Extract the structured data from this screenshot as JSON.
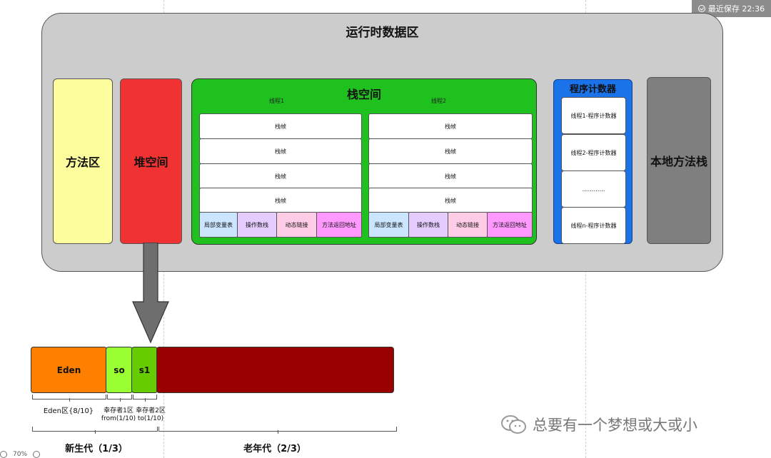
{
  "save_status": "最近保存 22:36",
  "runtime": {
    "title": "运行时数据区",
    "method_area": "方法区",
    "heap": "堆空间",
    "native_stack": "本地方法栈",
    "stack": {
      "title": "栈空间",
      "threads": [
        {
          "label": "线程1",
          "frames": [
            "栈帧",
            "栈帧",
            "栈帧",
            "栈帧"
          ],
          "parts": [
            "局部变量表",
            "操作数栈",
            "动态链接",
            "方法返回地址"
          ]
        },
        {
          "label": "线程2",
          "frames": [
            "栈帧",
            "栈帧",
            "栈帧",
            "栈帧"
          ],
          "parts": [
            "局部变量表",
            "操作数栈",
            "动态链接",
            "方法返回地址"
          ]
        }
      ]
    },
    "pc_register": {
      "title": "程序计数器",
      "items": [
        "线程1-程序计数器",
        "线程2-程序计数器",
        "…………",
        "线程n-程序计数器"
      ]
    }
  },
  "heap_layout": {
    "eden": "Eden",
    "s0": "so",
    "s1": "s1",
    "eden_label": "Eden区{8/10}",
    "s0_label_1": "幸存者1区",
    "s0_label_2": "from(1/10)",
    "s1_label_1": "幸存者2区",
    "s1_label_2": "to(1/10)",
    "young": "新生代（1/3）",
    "old": "老年代（2/3）"
  },
  "watermark": "总要有一个梦想或大或小",
  "zoom": "70%",
  "colors": {
    "method_area": "#fdfd9e",
    "heap": "#f03232",
    "stack": "#1ec11e",
    "pc": "#1a73e8",
    "native": "#7f7f7f",
    "eden": "#ff8000",
    "s0": "#99ff33",
    "s1": "#66cc00",
    "old": "#990000",
    "part_local": "#cce5ff",
    "part_operand": "#e5ccff",
    "part_dynamic": "#ffcce5",
    "part_return": "#ff99ff"
  }
}
